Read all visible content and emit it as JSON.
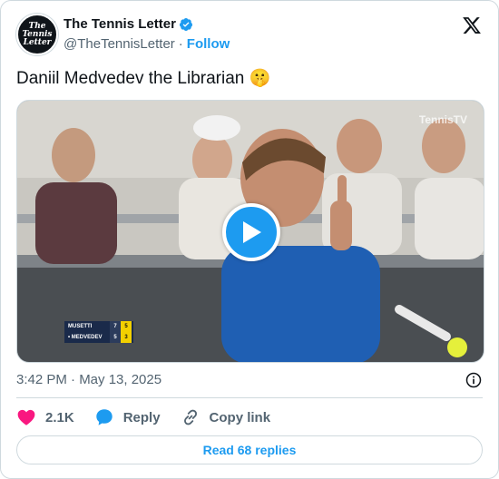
{
  "author": {
    "display_name": "The Tennis Letter",
    "handle": "@TheTennisLetter",
    "separator": "·",
    "follow_label": "Follow",
    "avatar_text": [
      "The",
      "Tennis",
      "Letter"
    ],
    "verified": true
  },
  "tweet": {
    "text": "Daniil Medvedev the Librarian 🤫",
    "timestamp": "3:42 PM · May 13, 2025"
  },
  "media": {
    "type": "video",
    "watermark": "TennisTV",
    "scoreboard": [
      {
        "player": "MUSETTI",
        "sets": "7",
        "games": "5",
        "serving": false
      },
      {
        "player": "MEDVEDEV",
        "sets": "5",
        "games": "3",
        "serving": true
      }
    ]
  },
  "actions": {
    "like_count": "2.1K",
    "reply_label": "Reply",
    "copy_link_label": "Copy link"
  },
  "footer": {
    "replies_label": "Read 68 replies"
  },
  "colors": {
    "accent": "#1d9bf0",
    "like": "#f91880",
    "text_primary": "#0f1419",
    "text_secondary": "#536471",
    "border": "#cfd9de"
  },
  "icons": [
    "verified-badge-icon",
    "x-logo-icon",
    "play-icon",
    "info-icon",
    "heart-icon",
    "reply-bubble-icon",
    "link-icon"
  ]
}
